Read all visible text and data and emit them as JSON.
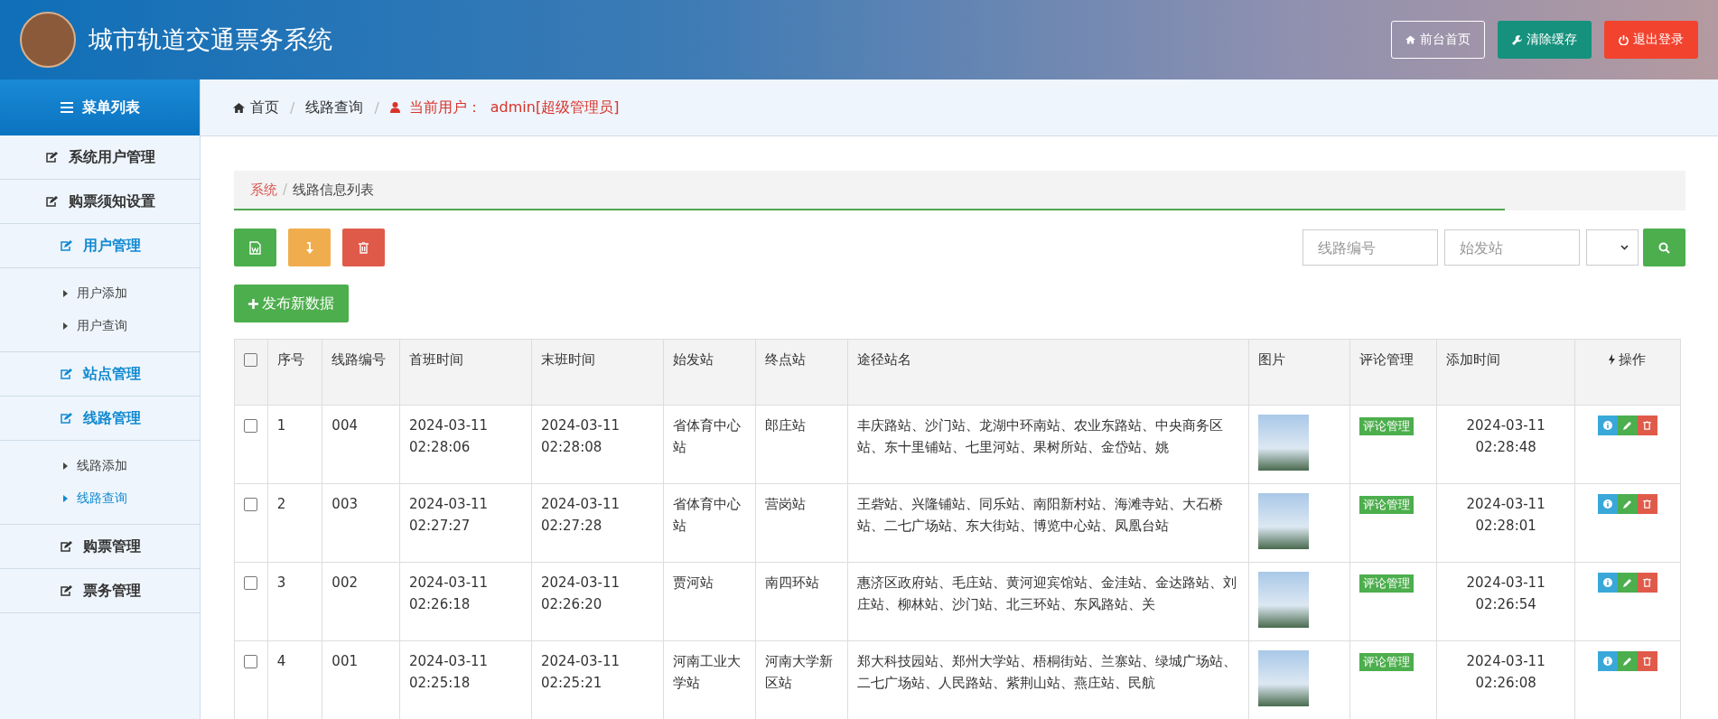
{
  "header": {
    "title": "城市轨道交通票务系统",
    "buttons": [
      {
        "label": "前台首页",
        "kind": "home"
      },
      {
        "label": "清除缓存",
        "kind": "clear"
      },
      {
        "label": "退出登录",
        "kind": "logout"
      }
    ]
  },
  "sidebar": {
    "title": "菜单列表",
    "items": [
      {
        "label": "系统用户管理",
        "highlighted": false
      },
      {
        "label": "购票须知设置",
        "highlighted": false
      },
      {
        "label": "用户管理",
        "highlighted": true,
        "children": [
          {
            "label": "用户添加",
            "selected": false
          },
          {
            "label": "用户查询",
            "selected": false
          }
        ]
      },
      {
        "label": "站点管理",
        "highlighted": true
      },
      {
        "label": "线路管理",
        "highlighted": true,
        "children": [
          {
            "label": "线路添加",
            "selected": false
          },
          {
            "label": "线路查询",
            "selected": true
          }
        ]
      },
      {
        "label": "购票管理",
        "highlighted": false
      },
      {
        "label": "票务管理",
        "highlighted": false
      }
    ]
  },
  "breadcrumb": {
    "separator": "/",
    "items": [
      "首页",
      "线路查询"
    ],
    "user_label": "当前用户：",
    "user": "admin[超级管理员]"
  },
  "panel": {
    "crumbs": [
      "系统",
      "线路信息列表"
    ],
    "crumb_separator": "/",
    "search": {
      "fields": [
        {
          "placeholder": "线路编号"
        },
        {
          "placeholder": "始发站"
        }
      ]
    },
    "add_button": "发布新数据",
    "table": {
      "header_checked": false,
      "columns": [
        "序号",
        "线路编号",
        "首班时间",
        "末班时间",
        "始发站",
        "终点站",
        "途径站名",
        "图片",
        "评论管理",
        "添加时间",
        "操作"
      ],
      "rows": [
        {
          "checked": false,
          "cells": [
            "1",
            "004",
            "2024-03-11 02:28:06",
            "2024-03-11 02:28:08",
            "省体育中心站",
            "郎庄站",
            "丰庆路站、沙门站、龙湖中环南站、农业东路站、中央商务区站、东十里铺站、七里河站、果树所站、金岱站、姚"
          ],
          "review": "评论管理",
          "added": "2024-03-11 02:28:48"
        },
        {
          "checked": false,
          "cells": [
            "2",
            "003",
            "2024-03-11 02:27:27",
            "2024-03-11 02:27:28",
            "省体育中心站",
            "营岗站",
            "王砦站、兴隆铺站、同乐站、南阳新村站、海滩寺站、大石桥站、二七广场站、东大街站、博览中心站、凤凰台站"
          ],
          "review": "评论管理",
          "added": "2024-03-11 02:28:01"
        },
        {
          "checked": false,
          "cells": [
            "3",
            "002",
            "2024-03-11 02:26:18",
            "2024-03-11 02:26:20",
            "贾河站",
            "南四环站",
            "惠济区政府站、毛庄站、黄河迎宾馆站、金洼站、金达路站、刘庄站、柳林站、沙门站、北三环站、东风路站、关"
          ],
          "review": "评论管理",
          "added": "2024-03-11 02:26:54"
        },
        {
          "checked": false,
          "cells": [
            "4",
            "001",
            "2024-03-11 02:25:18",
            "2024-03-11 02:25:21",
            "河南工业大学站",
            "河南大学新区站",
            "郑大科技园站、郑州大学站、梧桐街站、兰寨站、绿城广场站、二七广场站、人民路站、紫荆山站、燕庄站、民航"
          ],
          "review": "评论管理",
          "added": "2024-03-11 02:26:08"
        }
      ]
    }
  }
}
